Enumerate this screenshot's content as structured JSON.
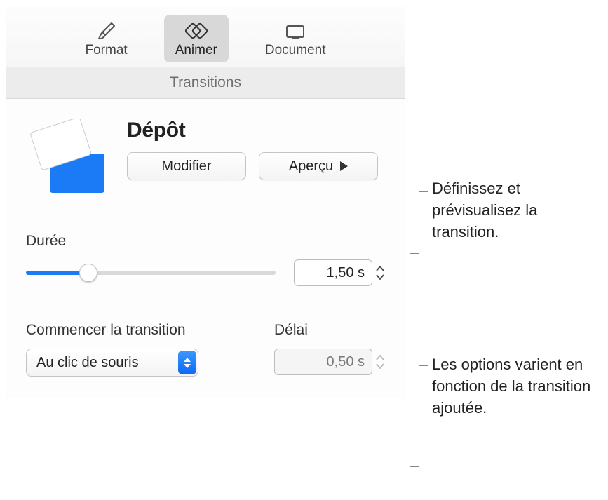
{
  "toolbar": {
    "format": "Format",
    "animate": "Animer",
    "document": "Document"
  },
  "section_header": "Transitions",
  "transition": {
    "name": "Dépôt",
    "modify_label": "Modifier",
    "preview_label": "Aperçu"
  },
  "duration": {
    "label": "Durée",
    "value": "1,50 s"
  },
  "start": {
    "label": "Commencer la transition",
    "value": "Au clic de souris"
  },
  "delay": {
    "label": "Délai",
    "value": "0,50 s"
  },
  "callouts": {
    "top": "Définissez et prévisualisez la transition.",
    "bottom": "Les options varient en fonction de la transition ajoutée."
  }
}
